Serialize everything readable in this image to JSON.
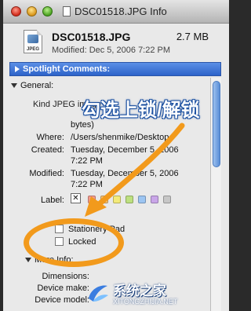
{
  "window": {
    "title": "DSC01518.JPG Info"
  },
  "header": {
    "icon_label": "JPEG",
    "file_name": "DSC01518.JPG",
    "file_size": "2.7 MB",
    "modified": "Modified: Dec 5, 2006 7:22 PM"
  },
  "spotlight": {
    "label": "Spotlight Comments:"
  },
  "general": {
    "heading": "General:",
    "kind_label": "Kind:",
    "kind_value": "Kind  JPEG image",
    "size_value": "bytes)",
    "where_label": "Where:",
    "where_value": "/Users/shenmike/Desktop",
    "created_label": "Created:",
    "created_line1": "Tuesday, December 5, 2006",
    "created_line2": "7:22 PM",
    "modified_label": "Modified:",
    "modified_line1": "Tuesday, December 5, 2006",
    "modified_line2": "7:22 PM",
    "label_label": "Label:",
    "label_x": "✕",
    "label_colors": [
      "#f49a8c",
      "#f5c276",
      "#f3ea7a",
      "#bde07f",
      "#9cc5f2",
      "#c9a6e8",
      "#c7c7c7"
    ],
    "stationery": "Stationery Pad",
    "locked": "Locked"
  },
  "more_info": {
    "heading": "More Info:",
    "dimensions": "Dimensions:",
    "device_make": "Device make:",
    "device_model": "Device model:"
  },
  "overlay": {
    "annotation": "勾选上锁/解锁",
    "annotation_color": "#1a4fa0",
    "highlight_color": "#f29a1c",
    "watermark_main": "系统之家",
    "watermark_sub": "XITONGZHIJIA.NET"
  }
}
